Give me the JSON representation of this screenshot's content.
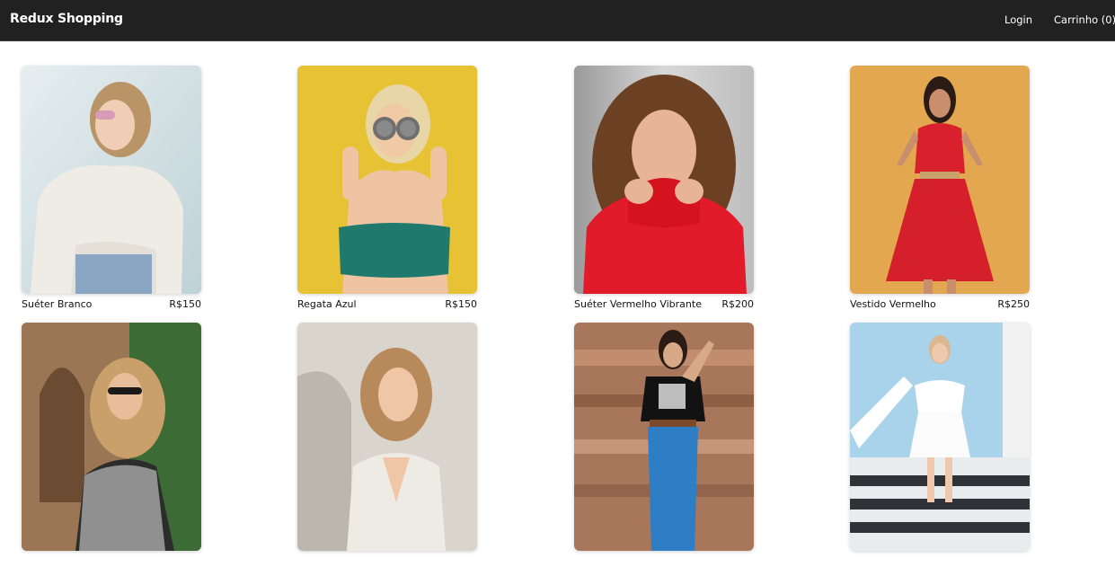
{
  "header": {
    "brand": "Redux Shopping",
    "login_label": "Login",
    "cart_label": "Carrinho (0)"
  },
  "products": [
    {
      "name": "Suéter Branco",
      "price": "R$150",
      "image": "woman-white-sweater-photo"
    },
    {
      "name": "Regata Azul",
      "price": "R$150",
      "image": "woman-teal-tank-top-photo"
    },
    {
      "name": "Suéter Vermelho Vibrante",
      "price": "R$200",
      "image": "woman-red-sweater-photo"
    },
    {
      "name": "Vestido Vermelho",
      "price": "R$250",
      "image": "woman-red-dress-photo"
    },
    {
      "name": "",
      "price": "",
      "image": "woman-plaid-blazer-photo"
    },
    {
      "name": "",
      "price": "",
      "image": "woman-knit-vest-photo"
    },
    {
      "name": "",
      "price": "",
      "image": "woman-graphic-tee-jeans-photo"
    },
    {
      "name": "",
      "price": "",
      "image": "woman-white-dress-stairs-photo"
    }
  ],
  "colors": {
    "header_bg": "#212121",
    "header_text": "#ffffff",
    "page_bg": "#ffffff"
  }
}
